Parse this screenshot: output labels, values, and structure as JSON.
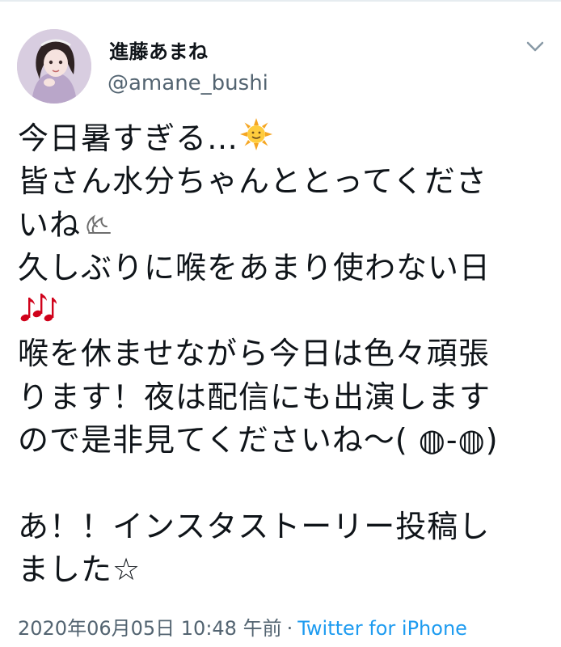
{
  "author": {
    "display_name": "進藤あまね",
    "handle": "@amane_bushi"
  },
  "tweet": {
    "lines": [
      "今日暑すぎる…",
      "皆さん水分ちゃんととってくださ",
      "いね",
      "久しぶりに喉をあまり使わない日",
      "",
      "喉を休ませながら今日は色々頑張",
      "ります！夜は配信にも出演します",
      "ので是非見てくださいね〜( ◍-◍)",
      "",
      "あ！！インスタストーリー投稿し",
      "ました☆"
    ],
    "emojis": [
      "sun-with-face-icon",
      "water-drop-icon",
      "music-notes-icon"
    ]
  },
  "meta": {
    "timestamp": "2020年06月05日 10:48 午前",
    "separator": "·",
    "source": "Twitter for iPhone"
  },
  "colors": {
    "text": "#0f1419",
    "secondary": "#536471",
    "link": "#1d9bf0",
    "music": "#d0021b",
    "sun": "#f5a623"
  }
}
